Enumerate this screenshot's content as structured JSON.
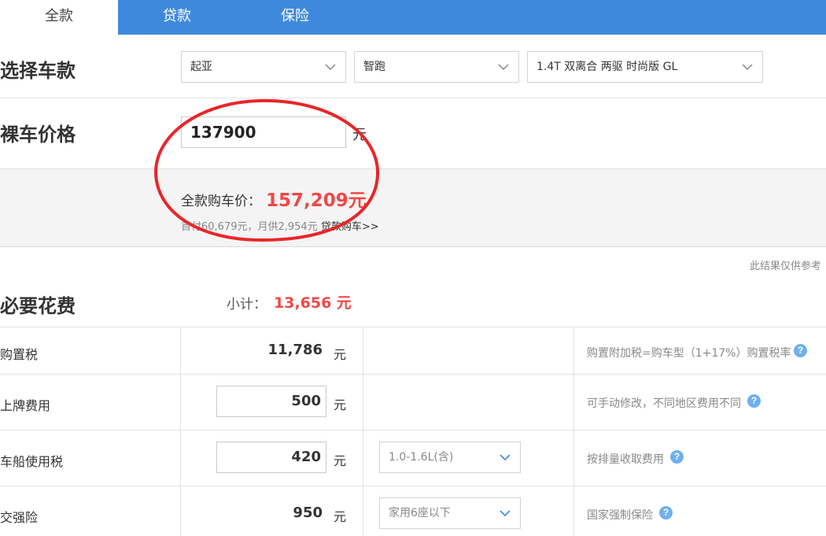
{
  "tabs": [
    {
      "label": "全款"
    },
    {
      "label": "贷款"
    },
    {
      "label": "保险"
    }
  ],
  "select_model": {
    "title": "选择车款",
    "brand": "起亚",
    "series": "智跑",
    "trim": "1.4T 双离合 两驱 时尚版 GL"
  },
  "bare_price": {
    "title": "裸车价格",
    "value": "137900",
    "unit": "元"
  },
  "summary": {
    "total_label": "全款购车价：",
    "total_value": "157,209元",
    "sub_text": "首付60,679元，月供2,954元",
    "loan_link": "贷款购车>>"
  },
  "disclaimer": "此结果仅供参考",
  "required": {
    "title": "必要花费",
    "subtotal_label": "小计：",
    "subtotal_value": "13,656 元",
    "rows": [
      {
        "label": "购置税",
        "value": "11,786",
        "unit": "元",
        "note": "购置附加税=购车型（1+17%）购置税率"
      },
      {
        "label": "上牌费用",
        "value": "500",
        "unit": "元",
        "note": "可手动修改，不同地区费用不同"
      },
      {
        "label": "车船使用税",
        "value": "420",
        "unit": "元",
        "option": "1.0-1.6L(含)",
        "note": "按排量收取费用"
      },
      {
        "label": "交强险",
        "value": "950",
        "unit": "元",
        "option": "家用6座以下",
        "note": "国家强制保险"
      }
    ]
  },
  "icons": {
    "dropdown": "chevron-down-icon",
    "help": "question-mark-icon"
  },
  "colors": {
    "tab_bar": "#3f89dc",
    "price_red": "#f04848",
    "annotation_red": "#e8262a",
    "help_blue": "#6fb0ef"
  }
}
